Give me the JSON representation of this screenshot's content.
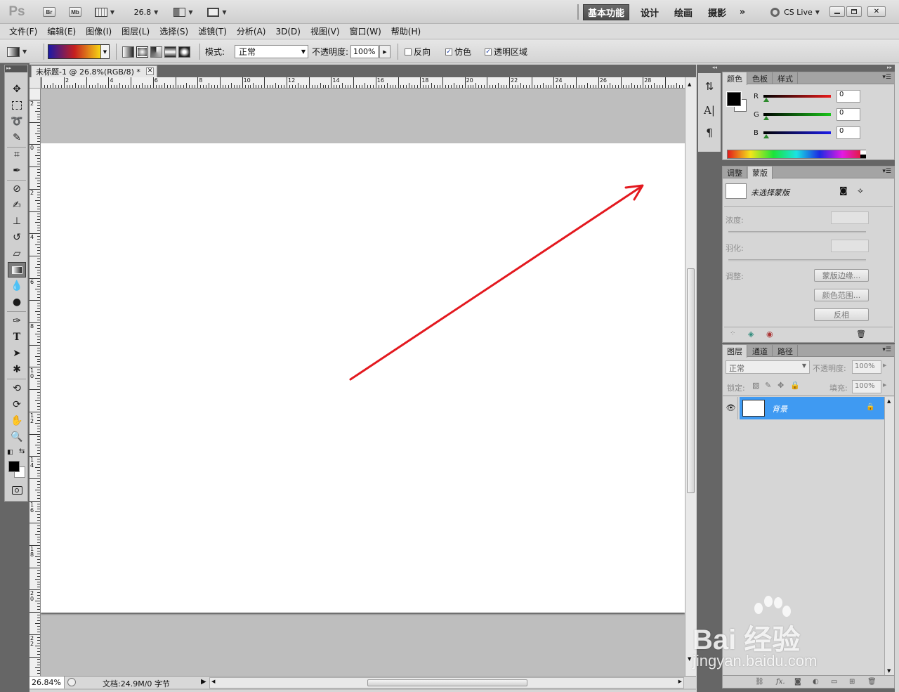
{
  "appbar": {
    "logo": "Ps",
    "bridge_btn": "Br",
    "minibridge_btn": "Mb",
    "zoom": "26.8",
    "workspaces": [
      "基本功能",
      "设计",
      "绘画",
      "摄影"
    ],
    "more": "»",
    "cs_live": "CS Live"
  },
  "menu": [
    "文件(F)",
    "编辑(E)",
    "图像(I)",
    "图层(L)",
    "选择(S)",
    "滤镜(T)",
    "分析(A)",
    "3D(D)",
    "视图(V)",
    "窗口(W)",
    "帮助(H)"
  ],
  "options": {
    "mode_label": "模式:",
    "mode_value": "正常",
    "opacity_label": "不透明度:",
    "opacity_value": "100%",
    "reverse_label": "反向",
    "dither_label": "仿色",
    "transparency_label": "透明区域",
    "reverse_checked": false,
    "dither_checked": true,
    "transparency_checked": true
  },
  "document": {
    "tab_title": "未标题-1 @ 26.8%(RGB/8) *",
    "zoom_status": "26.84%",
    "doc_info": "文档:24.9M/0 字节",
    "h_ruler_labels": [
      "2",
      "4",
      "6",
      "8",
      "10",
      "12",
      "14",
      "16",
      "18",
      "20",
      "22",
      "24",
      "26",
      "28"
    ],
    "v_ruler_labels": [
      "2",
      "0",
      "2",
      "4",
      "6",
      "8",
      "10",
      "12",
      "14",
      "16",
      "18",
      "20",
      "22"
    ]
  },
  "color_panel": {
    "tabs": [
      "颜色",
      "色板",
      "样式"
    ],
    "channels": [
      {
        "label": "R",
        "value": "0"
      },
      {
        "label": "G",
        "value": "0"
      },
      {
        "label": "B",
        "value": "0"
      }
    ]
  },
  "masks_panel": {
    "tabs": [
      "调整",
      "蒙版"
    ],
    "status": "未选择蒙版",
    "density_label": "浓度:",
    "feather_label": "羽化:",
    "refine_label": "调整:",
    "mask_edge_btn": "蒙版边缘...",
    "color_range_btn": "颜色范围...",
    "invert_btn": "反相"
  },
  "layers_panel": {
    "tabs": [
      "图层",
      "通道",
      "路径"
    ],
    "blend_mode": "正常",
    "opacity_label": "不透明度:",
    "opacity_value": "100%",
    "lock_label": "锁定:",
    "fill_label": "填充:",
    "fill_value": "100%",
    "layers": [
      {
        "name": "背景",
        "locked": true,
        "visible": true,
        "selected": true
      }
    ]
  },
  "watermark": {
    "brand": "Bai 经验",
    "url": "jingyan.baidu.com"
  },
  "colors": {
    "accent_selection": "#3f9af2",
    "workspace_active": "#555555",
    "arrow": "#e3191f"
  }
}
